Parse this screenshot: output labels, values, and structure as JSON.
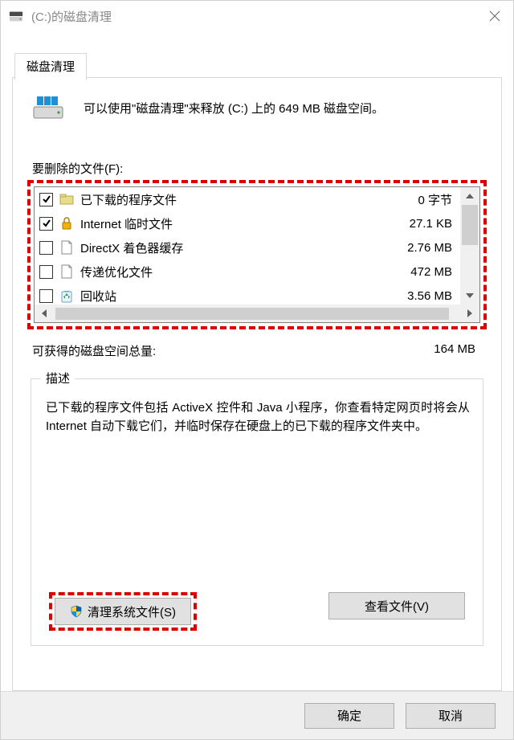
{
  "window": {
    "title": "(C:)的磁盘清理"
  },
  "tab": {
    "label": "磁盘清理"
  },
  "intro": "可以使用\"磁盘清理\"来释放 (C:) 上的 649 MB 磁盘空间。",
  "filesLabel": "要删除的文件(F):",
  "list": [
    {
      "checked": true,
      "icon": "folder",
      "name": "已下载的程序文件",
      "size": "0 字节"
    },
    {
      "checked": true,
      "icon": "lock",
      "name": "Internet 临时文件",
      "size": "27.1 KB"
    },
    {
      "checked": false,
      "icon": "file",
      "name": "DirectX 着色器缓存",
      "size": "2.76 MB"
    },
    {
      "checked": false,
      "icon": "file",
      "name": "传递优化文件",
      "size": "472 MB"
    },
    {
      "checked": false,
      "icon": "recycle",
      "name": "回收站",
      "size": "3.56 MB"
    }
  ],
  "totalLabel": "可获得的磁盘空间总量:",
  "totalValue": "164 MB",
  "descLegend": "描述",
  "descText": "已下载的程序文件包括 ActiveX 控件和 Java 小程序，你查看特定网页时将会从 Internet 自动下载它们，并临时保存在硬盘上的已下载的程序文件夹中。",
  "btnCleanSystem": "清理系统文件(S)",
  "btnViewFile": "查看文件(V)",
  "btnOk": "确定",
  "btnCancel": "取消"
}
